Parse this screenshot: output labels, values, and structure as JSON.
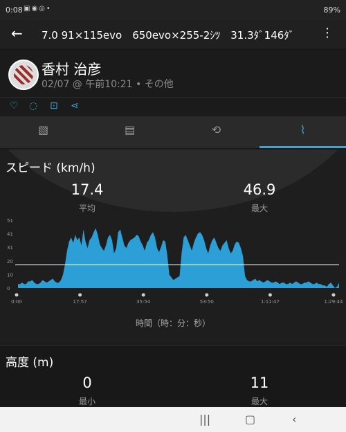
{
  "status": {
    "time": "0:08",
    "right": "89%"
  },
  "appbar": {
    "title": "7.0 91×115evo　650evo×255-2ｼﾂ　31.3ﾀﾞ146ﾀﾞ"
  },
  "profile": {
    "name": "香村 治彦",
    "subtitle": "02/07 @ 午前10:21 • その他"
  },
  "speed": {
    "title": "スピード (km/h)",
    "avg_value": "17.4",
    "avg_label": "平均",
    "max_value": "46.9",
    "max_label": "最大"
  },
  "chart_data": {
    "type": "area",
    "y_ticks": [
      "51",
      "41",
      "31",
      "20",
      "10",
      "0"
    ],
    "x_ticks": [
      "0:00",
      "17:57",
      "35:54",
      "53:50",
      "1:11:47",
      "1:29:44"
    ],
    "xlabel": "時間（時：分：秒）",
    "ylim": [
      0,
      51
    ],
    "avg_line": 17.4,
    "values": [
      3,
      3,
      4,
      3,
      3,
      5,
      5,
      6,
      4,
      3,
      3,
      4,
      6,
      5,
      4,
      5,
      6,
      7,
      5,
      4,
      4,
      6,
      10,
      18,
      28,
      35,
      38,
      34,
      40,
      36,
      38,
      32,
      44,
      35,
      30,
      36,
      38,
      42,
      45,
      40,
      33,
      30,
      28,
      32,
      38,
      40,
      36,
      26,
      30,
      42,
      44,
      38,
      32,
      30,
      34,
      36,
      37,
      38,
      40,
      39,
      35,
      32,
      28,
      34,
      36,
      40,
      42,
      38,
      30,
      27,
      31,
      36,
      35,
      25,
      10,
      8,
      6,
      7,
      8,
      9,
      26,
      38,
      40,
      36,
      32,
      28,
      34,
      38,
      41,
      42,
      40,
      36,
      30,
      26,
      32,
      36,
      38,
      34,
      30,
      28,
      32,
      34,
      36,
      30,
      26,
      28,
      33,
      35,
      34,
      30,
      24,
      9,
      6,
      5,
      5,
      6,
      7,
      5,
      6,
      5,
      4,
      5,
      6,
      5,
      4,
      4,
      5,
      4,
      3,
      4,
      4,
      3,
      3,
      4,
      3,
      4,
      5,
      4,
      3,
      3,
      4,
      4,
      5,
      4,
      3,
      3,
      4,
      3,
      3,
      2,
      2,
      1,
      3,
      4,
      2,
      0,
      1,
      4
    ]
  },
  "altitude": {
    "title": "高度 (m)",
    "min_value": "0",
    "min_label": "最小",
    "max_value": "11",
    "max_label": "最大"
  },
  "colors": {
    "accent": "#3aa6d8",
    "fill": "#2b9fd6"
  }
}
